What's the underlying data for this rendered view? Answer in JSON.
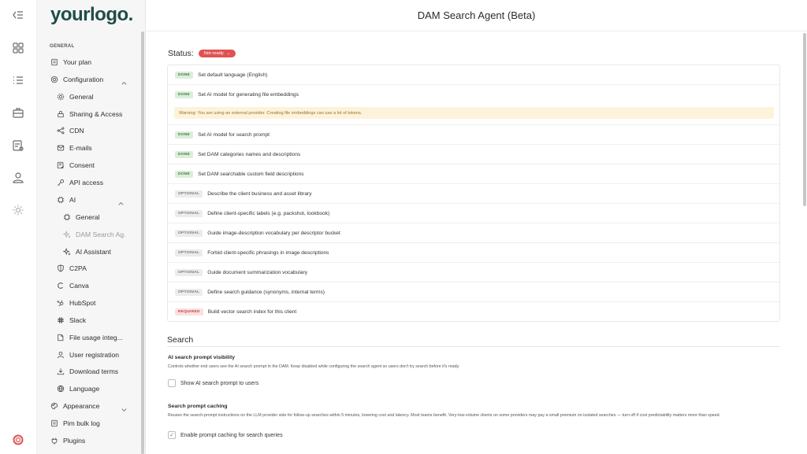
{
  "app": {
    "logo": "yourlogo.",
    "title": "DAM Search Agent (Beta)"
  },
  "rail": {
    "icons": [
      "collapse-icon",
      "grid-icon",
      "list-icon",
      "briefcase-icon",
      "document-icon",
      "user-icon",
      "gear-icon",
      "lifebuoy-icon"
    ]
  },
  "sidebar": {
    "section_label": "GENERAL",
    "items": {
      "your_plan": "Your plan",
      "configuration": "Configuration",
      "general": "General",
      "sharing_access": "Sharing & Access",
      "cdn": "CDN",
      "emails": "E-mails",
      "consent": "Consent",
      "api_access": "API access",
      "ai": "AI",
      "ai_general": "General",
      "dam_search": "DAM Search Ag.",
      "ai_assistant": "AI Assistant",
      "c2pa": "C2PA",
      "canva": "Canva",
      "hubspot": "HubSpot",
      "slack": "Slack",
      "file_usage": "File usage integ...",
      "user_registration": "User registration",
      "download_terms": "Download terms",
      "language": "Language",
      "appearance": "Appearance",
      "pim_bulk_log": "Pim bulk log",
      "plugins": "Plugins"
    }
  },
  "status": {
    "label": "Status:",
    "value": "Not ready",
    "color": "#e05252"
  },
  "checklist": [
    {
      "badge": "DONE",
      "kind": "done",
      "text": "Set default language (English)"
    },
    {
      "badge": "DONE",
      "kind": "done",
      "text": "Set AI model for generating file embeddings"
    },
    {
      "badge": "DONE",
      "kind": "done",
      "text": "Set AI model for search prompt"
    },
    {
      "badge": "DONE",
      "kind": "done",
      "text": "Set DAM categories names and descriptions"
    },
    {
      "badge": "DONE",
      "kind": "done",
      "text": "Set DAM searchable custom field descriptions"
    },
    {
      "badge": "OPTIONAL",
      "kind": "optional",
      "text": "Describe the client business and asset library"
    },
    {
      "badge": "OPTIONAL",
      "kind": "optional",
      "text": "Define client-specific labels (e.g. packshot, lookbook)"
    },
    {
      "badge": "OPTIONAL",
      "kind": "optional",
      "text": "Guide image-description vocabulary per descriptor bucket"
    },
    {
      "badge": "OPTIONAL",
      "kind": "optional",
      "text": "Forbid client-specific phrasings in image descriptions"
    },
    {
      "badge": "OPTIONAL",
      "kind": "optional",
      "text": "Guide document summarization vocabulary"
    },
    {
      "badge": "OPTIONAL",
      "kind": "optional",
      "text": "Define search guidance (synonyms, internal terms)"
    },
    {
      "badge": "REQUIRED",
      "kind": "required",
      "text": "Build vector search index for this client"
    }
  ],
  "warning": "Warning: You are using an external provider. Creating file embeddings can use a lot of tokens.",
  "search": {
    "title": "Search",
    "visibility": {
      "title": "AI search prompt visibility",
      "desc": "Controls whether end users see the AI search prompt in the DAM. Keep disabled while configuring the search agent so users don't try search before it's ready.",
      "checkbox_label": "Show AI search prompt to users",
      "checked": false
    },
    "caching": {
      "title": "Search prompt caching",
      "desc": "Reuses the search-prompt instructions on the LLM provider side for follow-up searches within 5 minutes, lowering cost and latency. Most teams benefit. Very-low-volume clients on some providers may pay a small premium on isolated searches — turn off if cost predictability matters more than speed.",
      "checkbox_label": "Enable prompt caching for search queries",
      "checked": true
    }
  }
}
